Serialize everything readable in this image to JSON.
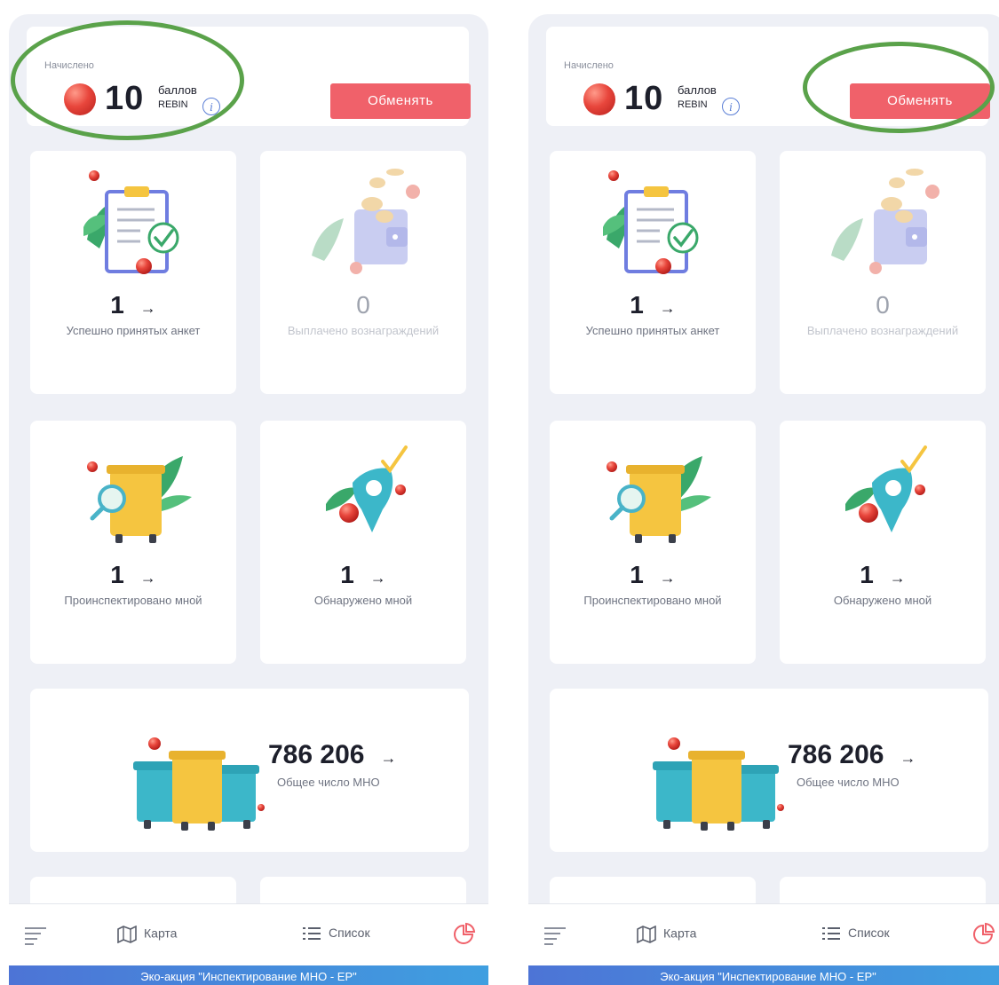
{
  "screens": [
    {
      "balance": {
        "accrued_label": "Начислено",
        "points": "10",
        "unit": "баллов",
        "token": "REBIN",
        "info_icon": "info-icon"
      },
      "exchange_button": "Обменять",
      "tiles": [
        {
          "value": "1",
          "arrow": "→",
          "caption": "Успешно принятых анкет",
          "muted": false
        },
        {
          "value": "0",
          "arrow": "",
          "caption": "Выплачено вознаграждений",
          "muted": true
        },
        {
          "value": "1",
          "arrow": "→",
          "caption": "Проинспектировано мной",
          "muted": false
        },
        {
          "value": "1",
          "arrow": "→",
          "caption": "Обнаружено мной",
          "muted": false
        }
      ],
      "total": {
        "value": "786 206",
        "arrow": "→",
        "caption": "Общее число МНО"
      },
      "tabbar": {
        "map": "Карта",
        "list": "Список"
      },
      "banner": "Эко-акция \"Инспектирование МНО - ЕР\"",
      "highlight": "balance"
    },
    {
      "balance": {
        "accrued_label": "Начислено",
        "points": "10",
        "unit": "баллов",
        "token": "REBIN",
        "info_icon": "info-icon"
      },
      "exchange_button": "Обменять",
      "tiles": [
        {
          "value": "1",
          "arrow": "→",
          "caption": "Успешно принятых анкет",
          "muted": false
        },
        {
          "value": "0",
          "arrow": "",
          "caption": "Выплачено вознаграждений",
          "muted": true
        },
        {
          "value": "1",
          "arrow": "→",
          "caption": "Проинспектировано мной",
          "muted": false
        },
        {
          "value": "1",
          "arrow": "→",
          "caption": "Обнаружено мной",
          "muted": false
        }
      ],
      "total": {
        "value": "786 206",
        "arrow": "→",
        "caption": "Общее число МНО"
      },
      "tabbar": {
        "map": "Карта",
        "list": "Список"
      },
      "banner": "Эко-акция \"Инспектирование МНО - ЕР\"",
      "highlight": "exchange-button"
    }
  ],
  "colors": {
    "accent_red": "#f0616a",
    "highlight_green": "#5aa24a",
    "banner_blue": "#4d74d6"
  }
}
